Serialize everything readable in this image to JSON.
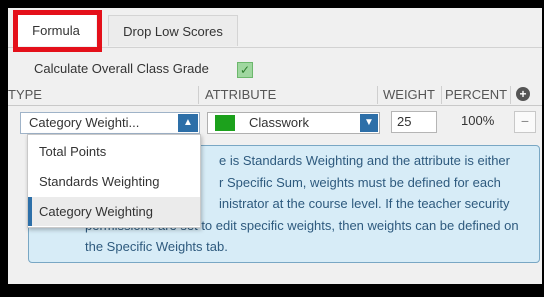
{
  "tabs": [
    {
      "label": "Formula",
      "active": true
    },
    {
      "label": "Drop Low Scores",
      "active": false
    }
  ],
  "calc_overall": {
    "label": "Calculate Overall Class Grade",
    "checked": true
  },
  "table": {
    "headers": {
      "type": "TYPE",
      "attribute": "ATTRIBUTE",
      "weight": "WEIGHT",
      "percent": "PERCENT"
    },
    "row": {
      "type_value": "Category Weighti...",
      "attribute_value": "Classwork",
      "attribute_color": "#1ca11c",
      "weight": "25",
      "percent": "100%"
    }
  },
  "type_dropdown": {
    "options": [
      "Total Points",
      "Standards Weighting",
      "Category Weighting"
    ],
    "selected": "Category Weighting"
  },
  "info": {
    "visible_lines": [
      "e is Standards Weighting and the attribute is either",
      "r Specific Sum, weights must be defined for each",
      "inistrator at the course level. If the teacher security",
      "permissions are set to edit specific weights, then weights can be defined on",
      "the Specific Weights tab."
    ]
  },
  "colors": {
    "highlight": "#e4101a",
    "accent": "#2d6fa8",
    "info_bg": "#d7ecf7"
  }
}
